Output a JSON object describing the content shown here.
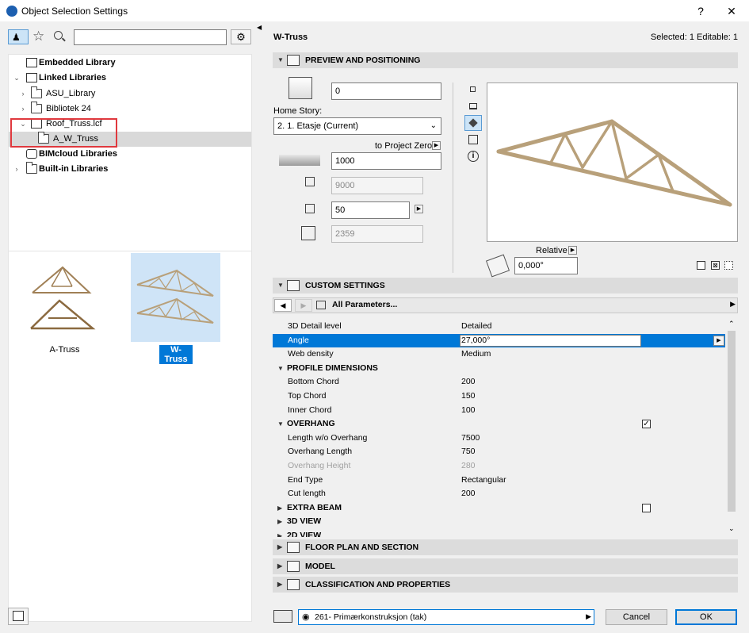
{
  "window": {
    "title": "Object Selection Settings",
    "help": "?",
    "close": "✕"
  },
  "toolbar": {
    "search_placeholder": ""
  },
  "tree": [
    {
      "label": "Embedded Library",
      "bold": true
    },
    {
      "label": "Linked Libraries",
      "bold": true
    },
    {
      "label": "ASU_Library",
      "bold": false
    },
    {
      "label": "Bibliotek 24",
      "bold": false
    },
    {
      "label": "Roof_Truss.lcf",
      "bold": false
    },
    {
      "label": "A_W_Truss",
      "bold": false
    },
    {
      "label": "BIMcloud Libraries",
      "bold": true
    },
    {
      "label": "Built-in Libraries",
      "bold": true
    }
  ],
  "thumbnails": [
    {
      "label": "A-Truss"
    },
    {
      "label": "W-Truss"
    }
  ],
  "header": {
    "object_name": "W-Truss",
    "selection_info": "Selected: 1 Editable: 1"
  },
  "preview": {
    "title": "PREVIEW AND POSITIONING",
    "elevation_value": "0",
    "home_story_label": "Home Story:",
    "home_story_value": "2. 1. Etasje (Current)",
    "to_project_zero": "to Project Zero",
    "height_value": "1000",
    "width_value": "9000",
    "depth_value": "50",
    "size_value": "2359",
    "relative_label": "Relative",
    "angle_value": "0,000°"
  },
  "custom": {
    "title": "CUSTOM SETTINGS",
    "params_dropdown": "All Parameters...",
    "rows": [
      {
        "name": "3D Detail level",
        "value": "Detailed",
        "type": "param"
      },
      {
        "name": "Angle",
        "value": "27,000°",
        "type": "selected"
      },
      {
        "name": "Web density",
        "value": "Medium",
        "type": "param"
      },
      {
        "name": "PROFILE DIMENSIONS",
        "value": "",
        "type": "group-open"
      },
      {
        "name": "Bottom Chord",
        "value": "200",
        "type": "param"
      },
      {
        "name": "Top Chord",
        "value": "150",
        "type": "param"
      },
      {
        "name": "Inner Chord",
        "value": "100",
        "type": "param"
      },
      {
        "name": "OVERHANG",
        "value": "",
        "type": "group-open-check"
      },
      {
        "name": "Length w/o Overhang",
        "value": "7500",
        "type": "param"
      },
      {
        "name": "Overhang Length",
        "value": "750",
        "type": "param"
      },
      {
        "name": "Overhang Height",
        "value": "280",
        "type": "disabled"
      },
      {
        "name": "End Type",
        "value": "Rectangular",
        "type": "param"
      },
      {
        "name": "Cut length",
        "value": "200",
        "type": "param"
      },
      {
        "name": "EXTRA BEAM",
        "value": "",
        "type": "group-closed-uncheck"
      },
      {
        "name": "3D VIEW",
        "value": "",
        "type": "group-closed"
      },
      {
        "name": "2D VIEW",
        "value": "",
        "type": "group-closed"
      }
    ]
  },
  "sections": {
    "floor_plan": "FLOOR PLAN AND SECTION",
    "model": "MODEL",
    "classification": "CLASSIFICATION AND PROPERTIES"
  },
  "footer": {
    "layer_value": "261- Primærkonstruksjon (tak)",
    "cancel": "Cancel",
    "ok": "OK"
  },
  "colors": {
    "accent": "#0078d7",
    "highlight": "#cfe4f7",
    "truss": "#b8a07a",
    "annotation": "#e0393e"
  }
}
